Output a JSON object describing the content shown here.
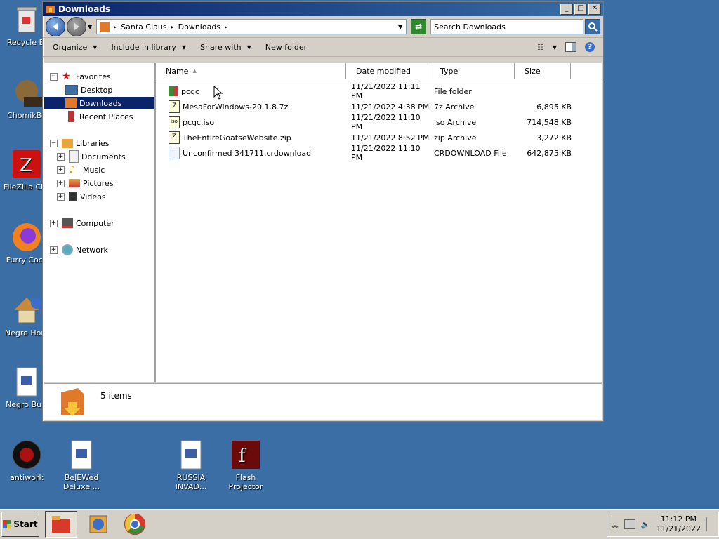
{
  "desktop": {
    "icons": [
      {
        "label": "Recycle Bi"
      },
      {
        "label": "ChomikBo"
      },
      {
        "label": "FileZilla Clie"
      },
      {
        "label": "Furry Cock"
      },
      {
        "label": "Negro Hom"
      },
      {
        "label": "Negro Burr"
      },
      {
        "label": "antiwork"
      },
      {
        "label": "BeJEWed Deluxe ..."
      },
      {
        "label": "RUSSIA INVAD..."
      },
      {
        "label": "Flash Projector"
      }
    ]
  },
  "window": {
    "title": "Downloads",
    "address": {
      "crumbs": [
        "Santa Claus",
        "Downloads"
      ]
    },
    "search_placeholder": "Search Downloads",
    "commands": {
      "organize": "Organize",
      "include": "Include in library",
      "share": "Share with",
      "new_folder": "New folder"
    },
    "nav": {
      "favorites": "Favorites",
      "desktop": "Desktop",
      "downloads": "Downloads",
      "recent": "Recent Places",
      "libraries": "Libraries",
      "documents": "Documents",
      "music": "Music",
      "pictures": "Pictures",
      "videos": "Videos",
      "computer": "Computer",
      "network": "Network"
    },
    "columns": {
      "name": "Name",
      "date": "Date modified",
      "type": "Type",
      "size": "Size"
    },
    "files": [
      {
        "name": "pcgc",
        "date": "11/21/2022 11:11 PM",
        "type": "File folder",
        "size": ""
      },
      {
        "name": "MesaForWindows-20.1.8.7z",
        "date": "11/21/2022 4:38 PM",
        "type": "7z Archive",
        "size": "6,895 KB"
      },
      {
        "name": "pcgc.iso",
        "date": "11/21/2022 11:10 PM",
        "type": "iso Archive",
        "size": "714,548 KB"
      },
      {
        "name": "TheEntireGoatseWebsite.zip",
        "date": "11/21/2022 8:52 PM",
        "type": "zip Archive",
        "size": "3,272 KB"
      },
      {
        "name": "Unconfirmed 341711.crdownload",
        "date": "11/21/2022 11:10 PM",
        "type": "CRDOWNLOAD File",
        "size": "642,875 KB"
      }
    ],
    "details": {
      "count": "5 items"
    }
  },
  "taskbar": {
    "start": "Start",
    "clock_time": "11:12 PM",
    "clock_date": "11/21/2022"
  }
}
